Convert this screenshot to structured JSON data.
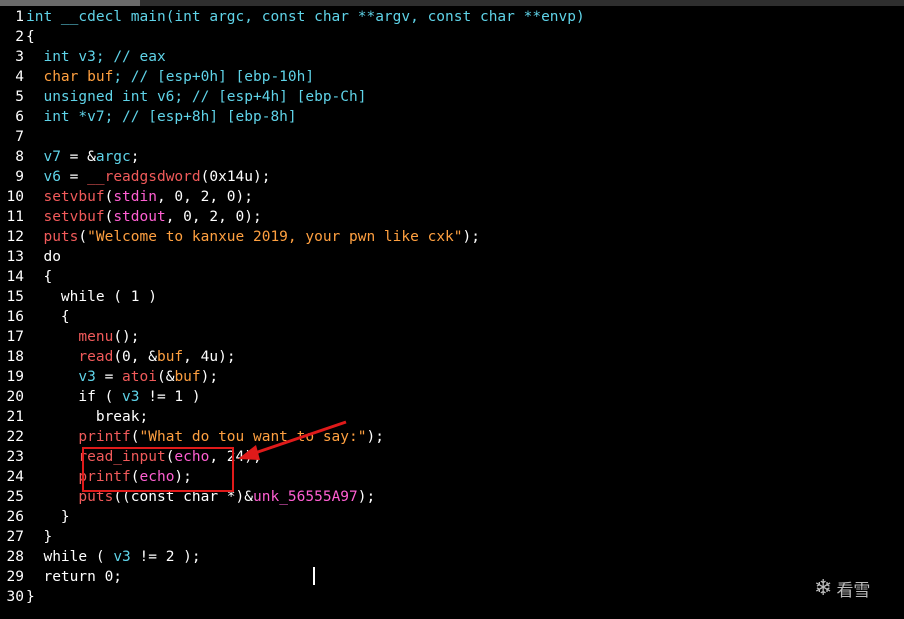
{
  "code": {
    "lines": [
      {
        "n": "1",
        "tokens": [
          {
            "t": "int __cdecl ",
            "c": "kw"
          },
          {
            "t": "main",
            "c": "kw"
          },
          {
            "t": "(int argc, const char **argv, const char **envp)",
            "c": "kw"
          }
        ]
      },
      {
        "n": "2",
        "tokens": [
          {
            "t": "{",
            "c": "nm"
          }
        ]
      },
      {
        "n": "3",
        "tokens": [
          {
            "t": "  int ",
            "c": "kw"
          },
          {
            "t": "v3",
            "c": "kw"
          },
          {
            "t": "; // eax",
            "c": "cm"
          }
        ]
      },
      {
        "n": "4",
        "tokens": [
          {
            "t": "  char ",
            "c": "st"
          },
          {
            "t": "buf",
            "c": "st"
          },
          {
            "t": "; // [esp+0h] [ebp-10h]",
            "c": "cm"
          }
        ]
      },
      {
        "n": "5",
        "tokens": [
          {
            "t": "  unsigned int ",
            "c": "kw"
          },
          {
            "t": "v6",
            "c": "kw"
          },
          {
            "t": "; // [esp+4h] [ebp-Ch]",
            "c": "cm"
          }
        ]
      },
      {
        "n": "6",
        "tokens": [
          {
            "t": "  int *",
            "c": "kw"
          },
          {
            "t": "v7",
            "c": "kw"
          },
          {
            "t": "; // [esp+8h] [ebp-8h]",
            "c": "cm"
          }
        ]
      },
      {
        "n": "7",
        "tokens": []
      },
      {
        "n": "8",
        "tokens": [
          {
            "t": "  v7",
            "c": "kw"
          },
          {
            "t": " = &",
            "c": "nm"
          },
          {
            "t": "argc",
            "c": "kw"
          },
          {
            "t": ";",
            "c": "nm"
          }
        ]
      },
      {
        "n": "9",
        "tokens": [
          {
            "t": "  v6",
            "c": "kw"
          },
          {
            "t": " = ",
            "c": "nm"
          },
          {
            "t": "__readgsdword",
            "c": "fn"
          },
          {
            "t": "(0x14u);",
            "c": "nm"
          }
        ]
      },
      {
        "n": "10",
        "tokens": [
          {
            "t": "  setvbuf",
            "c": "fn"
          },
          {
            "t": "(",
            "c": "nm"
          },
          {
            "t": "stdin",
            "c": "id"
          },
          {
            "t": ", 0, 2, 0);",
            "c": "nm"
          }
        ]
      },
      {
        "n": "11",
        "tokens": [
          {
            "t": "  setvbuf",
            "c": "fn"
          },
          {
            "t": "(",
            "c": "nm"
          },
          {
            "t": "stdout",
            "c": "id"
          },
          {
            "t": ", 0, 2, 0);",
            "c": "nm"
          }
        ]
      },
      {
        "n": "12",
        "tokens": [
          {
            "t": "  puts",
            "c": "fn"
          },
          {
            "t": "(",
            "c": "nm"
          },
          {
            "t": "\"Welcome to kanxue 2019, your pwn like cxk\"",
            "c": "st"
          },
          {
            "t": ");",
            "c": "nm"
          }
        ]
      },
      {
        "n": "13",
        "tokens": [
          {
            "t": "  do",
            "c": "nm"
          }
        ]
      },
      {
        "n": "14",
        "tokens": [
          {
            "t": "  {",
            "c": "nm"
          }
        ]
      },
      {
        "n": "15",
        "tokens": [
          {
            "t": "    while ( 1 )",
            "c": "nm"
          }
        ]
      },
      {
        "n": "16",
        "tokens": [
          {
            "t": "    {",
            "c": "nm"
          }
        ]
      },
      {
        "n": "17",
        "tokens": [
          {
            "t": "      menu",
            "c": "fn"
          },
          {
            "t": "();",
            "c": "nm"
          }
        ]
      },
      {
        "n": "18",
        "tokens": [
          {
            "t": "      read",
            "c": "fn"
          },
          {
            "t": "(0, &",
            "c": "nm"
          },
          {
            "t": "buf",
            "c": "st"
          },
          {
            "t": ", 4u);",
            "c": "nm"
          }
        ]
      },
      {
        "n": "19",
        "tokens": [
          {
            "t": "      v3",
            "c": "kw"
          },
          {
            "t": " = ",
            "c": "nm"
          },
          {
            "t": "atoi",
            "c": "fn"
          },
          {
            "t": "(&",
            "c": "nm"
          },
          {
            "t": "buf",
            "c": "st"
          },
          {
            "t": ");",
            "c": "nm"
          }
        ]
      },
      {
        "n": "20",
        "tokens": [
          {
            "t": "      if ( ",
            "c": "nm"
          },
          {
            "t": "v3",
            "c": "kw"
          },
          {
            "t": " != 1 )",
            "c": "nm"
          }
        ]
      },
      {
        "n": "21",
        "tokens": [
          {
            "t": "        break;",
            "c": "nm"
          }
        ]
      },
      {
        "n": "22",
        "tokens": [
          {
            "t": "      printf",
            "c": "fn"
          },
          {
            "t": "(",
            "c": "nm"
          },
          {
            "t": "\"What do tou want to say:\"",
            "c": "st"
          },
          {
            "t": ");",
            "c": "nm"
          }
        ]
      },
      {
        "n": "23",
        "tokens": [
          {
            "t": "      read_input",
            "c": "fn"
          },
          {
            "t": "(",
            "c": "nm"
          },
          {
            "t": "echo",
            "c": "id"
          },
          {
            "t": ", 24);",
            "c": "nm"
          }
        ]
      },
      {
        "n": "24",
        "tokens": [
          {
            "t": "      printf",
            "c": "fn"
          },
          {
            "t": "(",
            "c": "nm"
          },
          {
            "t": "echo",
            "c": "id"
          },
          {
            "t": ");",
            "c": "nm"
          }
        ]
      },
      {
        "n": "25",
        "tokens": [
          {
            "t": "      puts",
            "c": "fn"
          },
          {
            "t": "((const char *)&",
            "c": "nm"
          },
          {
            "t": "unk_56555A97",
            "c": "id"
          },
          {
            "t": ");",
            "c": "nm"
          }
        ]
      },
      {
        "n": "26",
        "tokens": [
          {
            "t": "    }",
            "c": "nm"
          }
        ]
      },
      {
        "n": "27",
        "tokens": [
          {
            "t": "  }",
            "c": "nm"
          }
        ]
      },
      {
        "n": "28",
        "tokens": [
          {
            "t": "  while ( ",
            "c": "nm"
          },
          {
            "t": "v3",
            "c": "kw"
          },
          {
            "t": " != 2 );",
            "c": "nm"
          }
        ]
      },
      {
        "n": "29",
        "tokens": [
          {
            "t": "  return 0;",
            "c": "nm"
          }
        ]
      },
      {
        "n": "30",
        "tokens": [
          {
            "t": "}",
            "c": "nm"
          }
        ]
      }
    ]
  },
  "annotation": {
    "color": "#e01a1a"
  },
  "watermark": {
    "icon": "snowflake-icon",
    "text": "看雪"
  }
}
